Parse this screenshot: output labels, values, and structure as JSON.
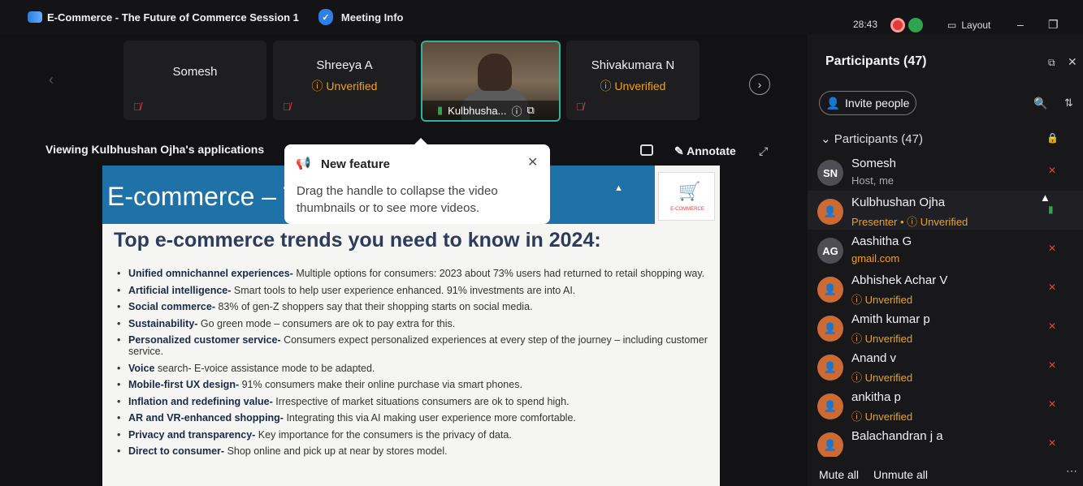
{
  "window": {
    "title": "E-Commerce - The Future of Commerce Session 1",
    "meeting_info": "Meeting Info",
    "timer": "28:43",
    "layout_label": "Layout"
  },
  "thumbnails": [
    {
      "name": "Somesh",
      "status": ""
    },
    {
      "name": "Shreeya A",
      "status": "Unverified"
    },
    {
      "name": "Kulbhusha...",
      "status": ""
    },
    {
      "name": "Shivakumara N",
      "status": "Unverified"
    }
  ],
  "viewing": {
    "label": "Viewing Kulbhushan Ojha's applications",
    "annotate": "Annotate"
  },
  "tooltip": {
    "title": "New feature",
    "body": "Drag the handle to collapse the video thumbnails or to see more videos."
  },
  "slide": {
    "banner_title": "E-commerce – T",
    "logo_text": "E-COMMERCE",
    "heading": "Top e-commerce trends you need to know in 2024:",
    "bullets": [
      {
        "bold": "Unified omnichannel experiences-",
        "text": " Multiple options for consumers: 2023 about 73% users had returned to retail shopping way."
      },
      {
        "bold": "Artificial intelligence-",
        "text": " Smart tools to help user experience enhanced. 91% investments are into AI."
      },
      {
        "bold": "Social commerce-",
        "text": " 83% of gen-Z shoppers say that their shopping starts on social media."
      },
      {
        "bold": "Sustainability-",
        "text": "  Go green mode – consumers are ok to pay extra for this."
      },
      {
        "bold": "Personalized customer service-",
        "text": " Consumers expect personalized experiences at every step of the journey – including customer service."
      },
      {
        "bold": "Voice",
        "text": " search- E-voice assistance mode to be adapted."
      },
      {
        "bold": "Mobile-first UX design-",
        "text": " 91% consumers make their online purchase via smart phones."
      },
      {
        "bold": "Inflation and redefining value-",
        "text": " Irrespective of market situations consumers are ok to spend high."
      },
      {
        "bold": "AR and VR-enhanced shopping-",
        "text": " Integrating this via AI making user experience more comfortable."
      },
      {
        "bold": "Privacy and transparency-",
        "text": " Key importance for the consumers is the privacy of data."
      },
      {
        "bold": "Direct to consumer-",
        "text": " Shop online and pick up at near by stores model."
      }
    ]
  },
  "panel": {
    "title": "Participants (47)",
    "invite_label": "Invite people",
    "section_label": "Participants (47)",
    "participants": [
      {
        "initials": "SN",
        "name": "Somesh",
        "sub": "Host, me",
        "sub_style": "plain",
        "avatar": "gray",
        "mic": "off"
      },
      {
        "initials": "",
        "name": "Kulbhushan Ojha",
        "sub": "Presenter • ⓘ Unverified",
        "sub_style": "orange",
        "avatar": "orange",
        "mic": "on"
      },
      {
        "initials": "AG",
        "name": "Aashitha G",
        "sub": "gmail.com",
        "sub_style": "orange",
        "avatar": "gray",
        "mic": "off"
      },
      {
        "initials": "",
        "name": "Abhishek Achar V",
        "sub": "ⓘ Unverified",
        "sub_style": "orange",
        "avatar": "orange",
        "mic": "off"
      },
      {
        "initials": "",
        "name": "Amith kumar p",
        "sub": "ⓘ Unverified",
        "sub_style": "orange",
        "avatar": "orange",
        "mic": "off"
      },
      {
        "initials": "",
        "name": "Anand v",
        "sub": "ⓘ Unverified",
        "sub_style": "orange",
        "avatar": "orange",
        "mic": "off"
      },
      {
        "initials": "",
        "name": "ankitha p",
        "sub": "ⓘ Unverified",
        "sub_style": "orange",
        "avatar": "orange",
        "mic": "off"
      },
      {
        "initials": "",
        "name": "Balachandran j a",
        "sub": "",
        "sub_style": "orange",
        "avatar": "orange",
        "mic": "off"
      }
    ],
    "mute_all": "Mute all",
    "unmute_all": "Unmute all"
  },
  "colors": {
    "accent_teal": "#2fb49b",
    "unverified_orange": "#f0a020",
    "mic_red": "#e34343",
    "slide_blue": "#1f72a8"
  }
}
